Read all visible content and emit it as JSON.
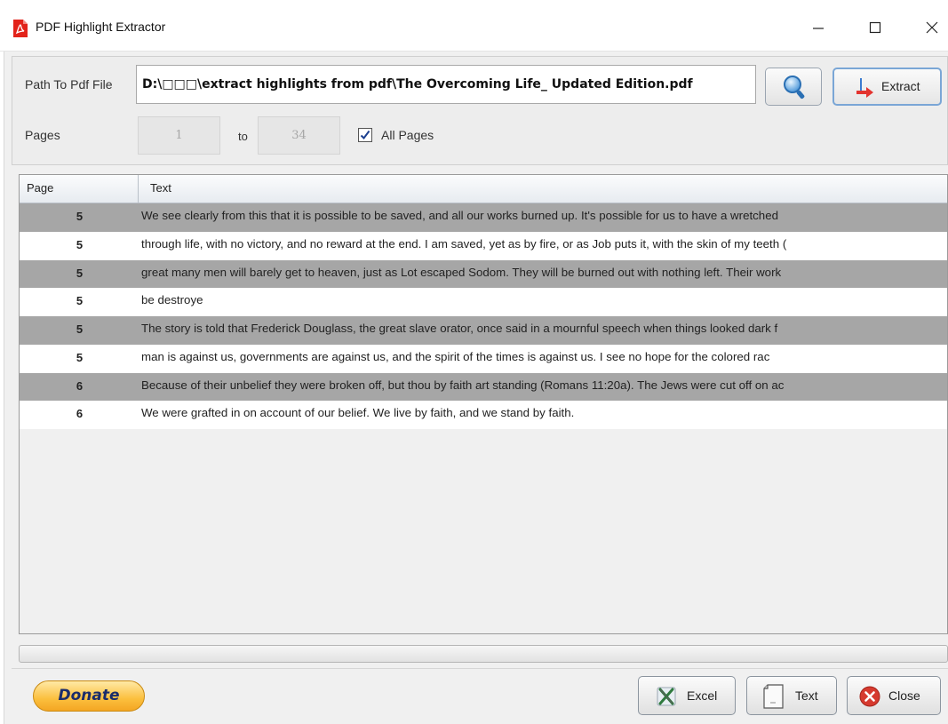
{
  "window": {
    "title": "PDF Highlight Extractor"
  },
  "form": {
    "path_label": "Path To Pdf File",
    "path_value": "D:\\□□□\\extract highlights from pdf\\The Overcoming Life_ Updated Edition.pdf",
    "extract_label": "Extract",
    "pages_label": "Pages",
    "page_from": "1",
    "to_label": "to",
    "page_to": "34",
    "all_pages_label": "All Pages",
    "all_pages_checked": true
  },
  "table": {
    "columns": [
      "Page",
      "Text"
    ],
    "rows": [
      {
        "page": "5",
        "text": "We see clearly from this that it is possible to be saved, and all our works burned up. It's possible for us to have a wretched"
      },
      {
        "page": "5",
        "text": "through life, with no victory, and no reward at the end. I am saved, yet as by fire, or as Job puts it, with the skin of my teeth ("
      },
      {
        "page": "5",
        "text": "great many men will barely get to heaven, just as Lot escaped Sodom. They will be burned out with nothing left. Their work"
      },
      {
        "page": "5",
        "text": "be destroye"
      },
      {
        "page": "5",
        "text": "The story is told that Frederick Douglass, the great slave orator, once said in a mournful speech when things looked dark f"
      },
      {
        "page": "5",
        "text": "man is against us, governments are against us, and the spirit of the times is against us. I see no hope for the colored rac"
      },
      {
        "page": "6",
        "text": "Because of their unbelief they were broken off, but thou by faith art standing (Romans 11:20a). The Jews were cut off on ac"
      },
      {
        "page": "6",
        "text": "We were grafted in on account of our belief. We live by faith, and we stand by faith."
      }
    ]
  },
  "footer": {
    "donate_label": "Donate",
    "excel_label": "Excel",
    "text_label": "Text",
    "close_label": "Close"
  },
  "icons": {
    "app": "pdf-icon",
    "search": "magnifier-icon",
    "extract": "extract-arrow-icon",
    "excel": "excel-icon",
    "text": "text-file-icon",
    "close": "close-red-icon"
  },
  "colors": {
    "row_shaded": "#a6a6a6",
    "row_plain": "#ffffff",
    "donate_gold": "#fbbf3d",
    "extract_border": "#7aa6d6",
    "close_red": "#d63a2f"
  }
}
